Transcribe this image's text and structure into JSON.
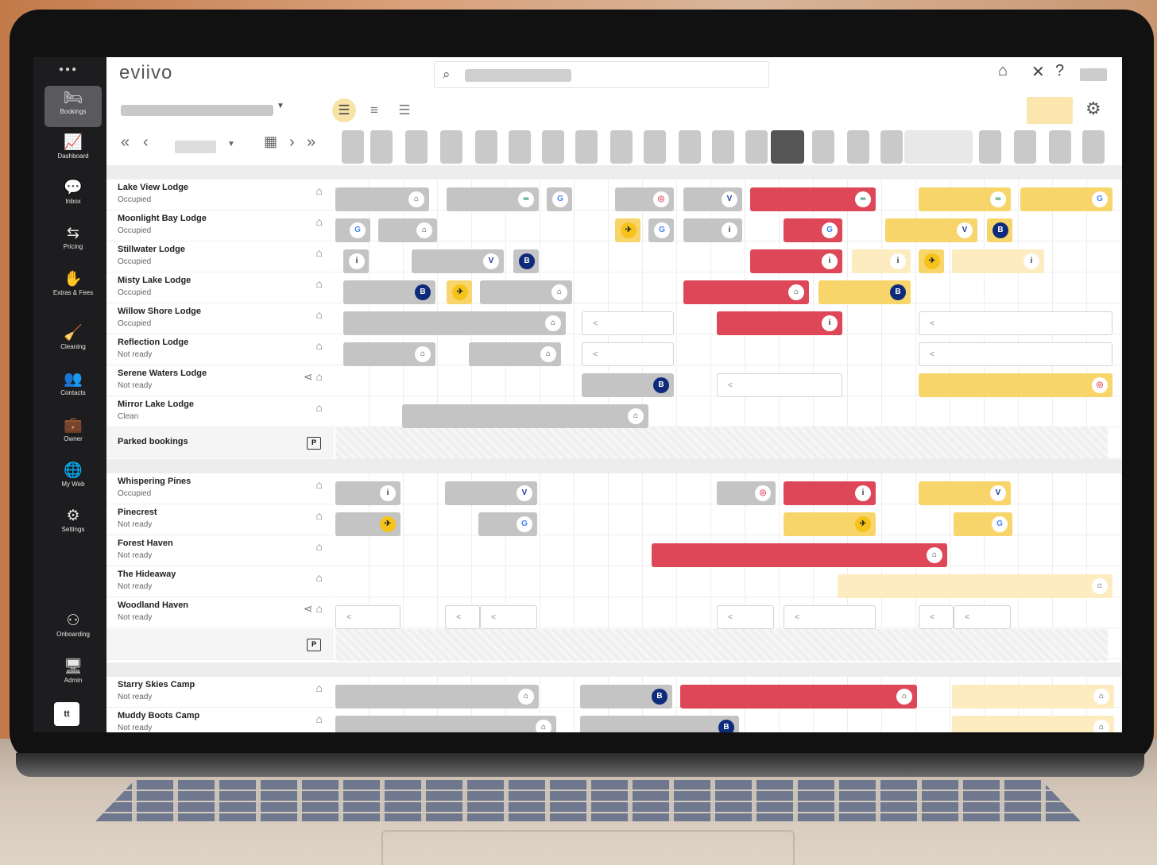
{
  "app": {
    "logo": "eviivo",
    "avatar": "tt"
  },
  "sidebar": {
    "items": [
      {
        "label": "Bookings",
        "icon": "bed-icon",
        "glyph": "🛏"
      },
      {
        "label": "Dashboard",
        "icon": "chart-icon",
        "glyph": "📈"
      },
      {
        "label": "Inbox",
        "icon": "chat-icon",
        "glyph": "💬"
      },
      {
        "label": "Pricing",
        "icon": "sliders-icon",
        "glyph": "⇆"
      },
      {
        "label": "Extras & Fees",
        "icon": "hand-money-icon",
        "glyph": "✋"
      },
      {
        "label": "Cleaning",
        "icon": "broom-icon",
        "glyph": "🧹"
      },
      {
        "label": "Contacts",
        "icon": "contacts-icon",
        "glyph": "👥"
      },
      {
        "label": "Owner",
        "icon": "briefcase-icon",
        "glyph": "💼"
      },
      {
        "label": "My Web",
        "icon": "globe-icon",
        "glyph": "🌐"
      },
      {
        "label": "Settings",
        "icon": "gear-icon",
        "glyph": "⚙"
      },
      {
        "label": "Onboarding",
        "icon": "onboarding-icon",
        "glyph": "⚇"
      },
      {
        "label": "Admin",
        "icon": "monitor-icon",
        "glyph": "🖥"
      }
    ]
  },
  "header": {
    "search_icon": "search-icon",
    "icons": [
      "building-icon",
      "close-icon",
      "help-icon"
    ]
  },
  "rooms_group1": [
    {
      "name": "Lake View Lodge",
      "status": "Occupied"
    },
    {
      "name": "Moonlight Bay Lodge",
      "status": "Occupied"
    },
    {
      "name": "Stillwater Lodge",
      "status": "Occupied"
    },
    {
      "name": "Misty Lake Lodge",
      "status": "Occupied"
    },
    {
      "name": "Willow Shore Lodge",
      "status": "Occupied"
    },
    {
      "name": "Reflection Lodge",
      "status": "Not ready"
    },
    {
      "name": "Serene Waters Lodge",
      "status": "Not ready"
    },
    {
      "name": "Mirror Lake Lodge",
      "status": "Clean"
    }
  ],
  "parked": {
    "label": "Parked bookings",
    "badge": "P"
  },
  "rooms_group2": [
    {
      "name": "Whispering Pines",
      "status": "Occupied"
    },
    {
      "name": "Pinecrest",
      "status": "Not ready"
    },
    {
      "name": "Forest Haven",
      "status": "Not ready"
    },
    {
      "name": "The Hideaway",
      "status": "Not ready"
    },
    {
      "name": "Woodland Haven",
      "status": "Not ready"
    }
  ],
  "parked2": {
    "badge": "P"
  },
  "rooms_group3": [
    {
      "name": "Starry Skies Camp",
      "status": "Not ready"
    },
    {
      "name": "Muddy Boots Camp",
      "status": "Not ready"
    }
  ],
  "channels": {
    "a": "◎",
    "e": "∞",
    "v": "V",
    "g": "G",
    "b": "B",
    "t": "✈",
    "h": "⌂",
    "i": "i",
    "s": "<"
  },
  "colors": {
    "cancelled_red": "#dd4757",
    "yellow": "#f8d56b",
    "grey": "#c4c4c4",
    "today": "#555555"
  }
}
